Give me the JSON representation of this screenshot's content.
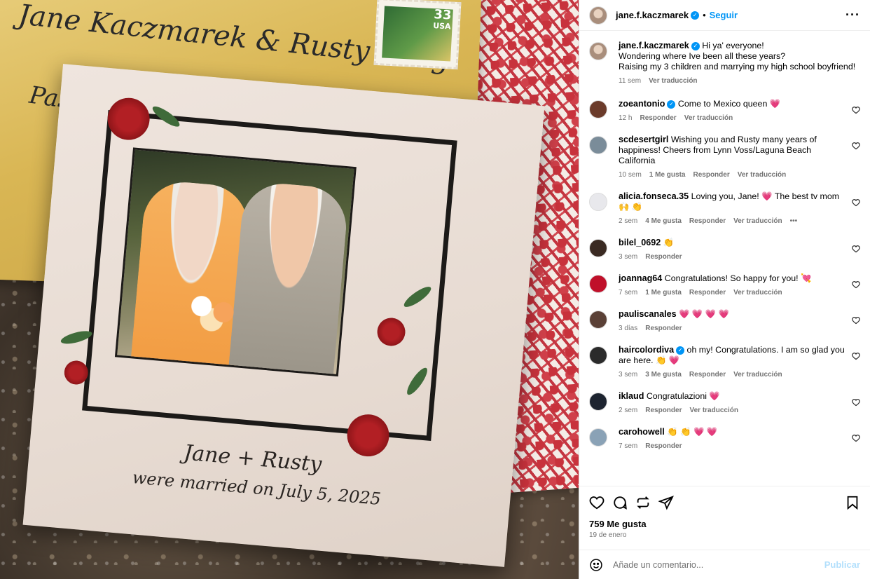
{
  "photo": {
    "envelope_line1": "Jane Kaczmarek & Rusty Long",
    "envelope_line2": "Pas...",
    "stamp_value": "33",
    "stamp_country": "USA",
    "card_names": "Jane + Rusty",
    "card_date": "were married on July 5, 2025"
  },
  "header": {
    "username": "jane.f.kaczmarek",
    "separator": "•",
    "follow_label": "Seguir",
    "more_label": "···"
  },
  "caption": {
    "username": "jane.f.kaczmarek",
    "line1": "Hi ya' everyone!",
    "line2": "Wondering where Ive been all these years?",
    "line3": "Raising my 3 children and marrying my high school boyfriend!",
    "time": "11 sem",
    "translate": "Ver traducción"
  },
  "comments": [
    {
      "user": "zoeantonio",
      "verified": true,
      "text": "Come to Mexico queen",
      "emoji": "💗",
      "time": "12 h",
      "likes": "",
      "reply": "Responder",
      "translate": "Ver traducción",
      "avatar_color": "#6b3b2a"
    },
    {
      "user": "scdesertgirl",
      "verified": false,
      "text": "Wishing you and Rusty many years of happiness! Cheers from Lynn Voss/Laguna Beach California",
      "emoji": "",
      "time": "10 sem",
      "likes": "1 Me gusta",
      "reply": "Responder",
      "translate": "Ver traducción",
      "avatar_color": "#7a8c99"
    },
    {
      "user": "alicia.fonseca.35",
      "verified": false,
      "text": "Loving you, Jane! 💗 The best tv mom 🙌",
      "emoji": "👏",
      "time": "2 sem",
      "likes": "4 Me gusta",
      "reply": "Responder",
      "translate": "Ver traducción",
      "more": "•••",
      "avatar_color": "#e8e8ec"
    },
    {
      "user": "bilel_0692",
      "verified": false,
      "text": "",
      "emoji": "👏",
      "time": "3 sem",
      "likes": "",
      "reply": "Responder",
      "translate": "",
      "avatar_color": "#3a2a22"
    },
    {
      "user": "joannag64",
      "verified": false,
      "text": "Congratulations! So happy for you!",
      "emoji": "💘",
      "time": "7 sem",
      "likes": "1 Me gusta",
      "reply": "Responder",
      "translate": "Ver traducción",
      "avatar_color": "#c0102a"
    },
    {
      "user": "pauliscanales",
      "verified": false,
      "text": "",
      "emoji": "💗 💗 💗 💗",
      "time": "3 días",
      "likes": "",
      "reply": "Responder",
      "translate": "",
      "avatar_color": "#5a4036"
    },
    {
      "user": "haircolordiva",
      "verified": true,
      "text": "oh my! Congratulations. I am so glad you are here.",
      "emoji": "👏 💗",
      "time": "3 sem",
      "likes": "3 Me gusta",
      "reply": "Responder",
      "translate": "Ver traducción",
      "avatar_color": "#2b2b2b"
    },
    {
      "user": "iklaud",
      "verified": false,
      "text": "Congratulazioni",
      "emoji": "💗",
      "time": "2 sem",
      "likes": "",
      "reply": "Responder",
      "translate": "Ver traducción",
      "avatar_color": "#1d2430"
    },
    {
      "user": "carohowell",
      "verified": false,
      "text": "",
      "emoji": "👏 👏 💗 💗",
      "time": "7 sem",
      "likes": "",
      "reply": "Responder",
      "translate": "",
      "avatar_color": "#8aa2b6"
    }
  ],
  "footer": {
    "likes": "759 Me gusta",
    "date": "19 de enero",
    "comment_placeholder": "Añade un comentario...",
    "publish_label": "Publicar"
  },
  "icons": {
    "like": "heart-icon",
    "comment": "comment-icon",
    "share": "repost-icon",
    "send": "send-icon",
    "save": "bookmark-icon",
    "emoji": "emoji-icon"
  },
  "colors": {
    "link": "#0095f6",
    "publish_disabled": "#b2dffc",
    "meta": "#737373",
    "verified": "#0095f6"
  }
}
